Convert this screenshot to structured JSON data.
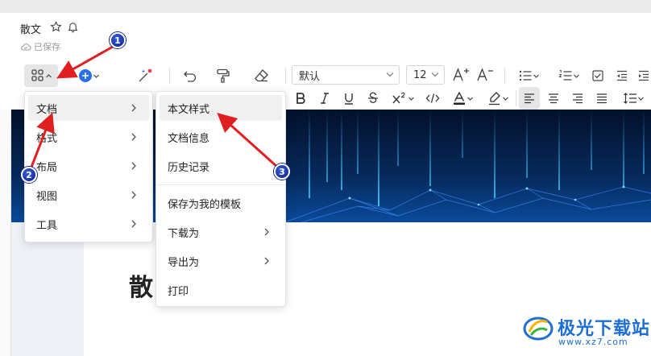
{
  "document": {
    "title": "散文",
    "save_status": "已保存",
    "heading": "散"
  },
  "toolbar": {
    "font_family": "默认",
    "font_size": "12",
    "apps_icon": "grid-icon",
    "insert_icon": "plus-circle-icon",
    "ai_icon": "magic-wand-icon"
  },
  "main_menu": {
    "items": [
      {
        "label": "文档",
        "has_submenu": true,
        "highlighted": true
      },
      {
        "label": "格式",
        "has_submenu": true
      },
      {
        "label": "布局",
        "has_submenu": true
      },
      {
        "label": "视图",
        "has_submenu": true
      },
      {
        "label": "工具",
        "has_submenu": true
      }
    ]
  },
  "submenu": {
    "items": [
      {
        "label": "本文样式",
        "highlighted": true
      },
      {
        "label": "文档信息"
      },
      {
        "label": "历史记录"
      },
      {
        "label": "保存为我的模板"
      },
      {
        "label": "下载为",
        "has_submenu": true
      },
      {
        "label": "导出为",
        "has_submenu": true
      },
      {
        "label": "打印"
      }
    ]
  },
  "annotations": {
    "step1": "1",
    "step2": "2",
    "step3": "3",
    "arrow_color": "#e02020"
  },
  "watermark": {
    "name": "极光下载站",
    "url": "www.xz7.com"
  },
  "colors": {
    "accent": "#2b6fe6",
    "badge": "#0a1f8a",
    "banner": "#061a3a",
    "content_bg": "#eef1f6"
  }
}
